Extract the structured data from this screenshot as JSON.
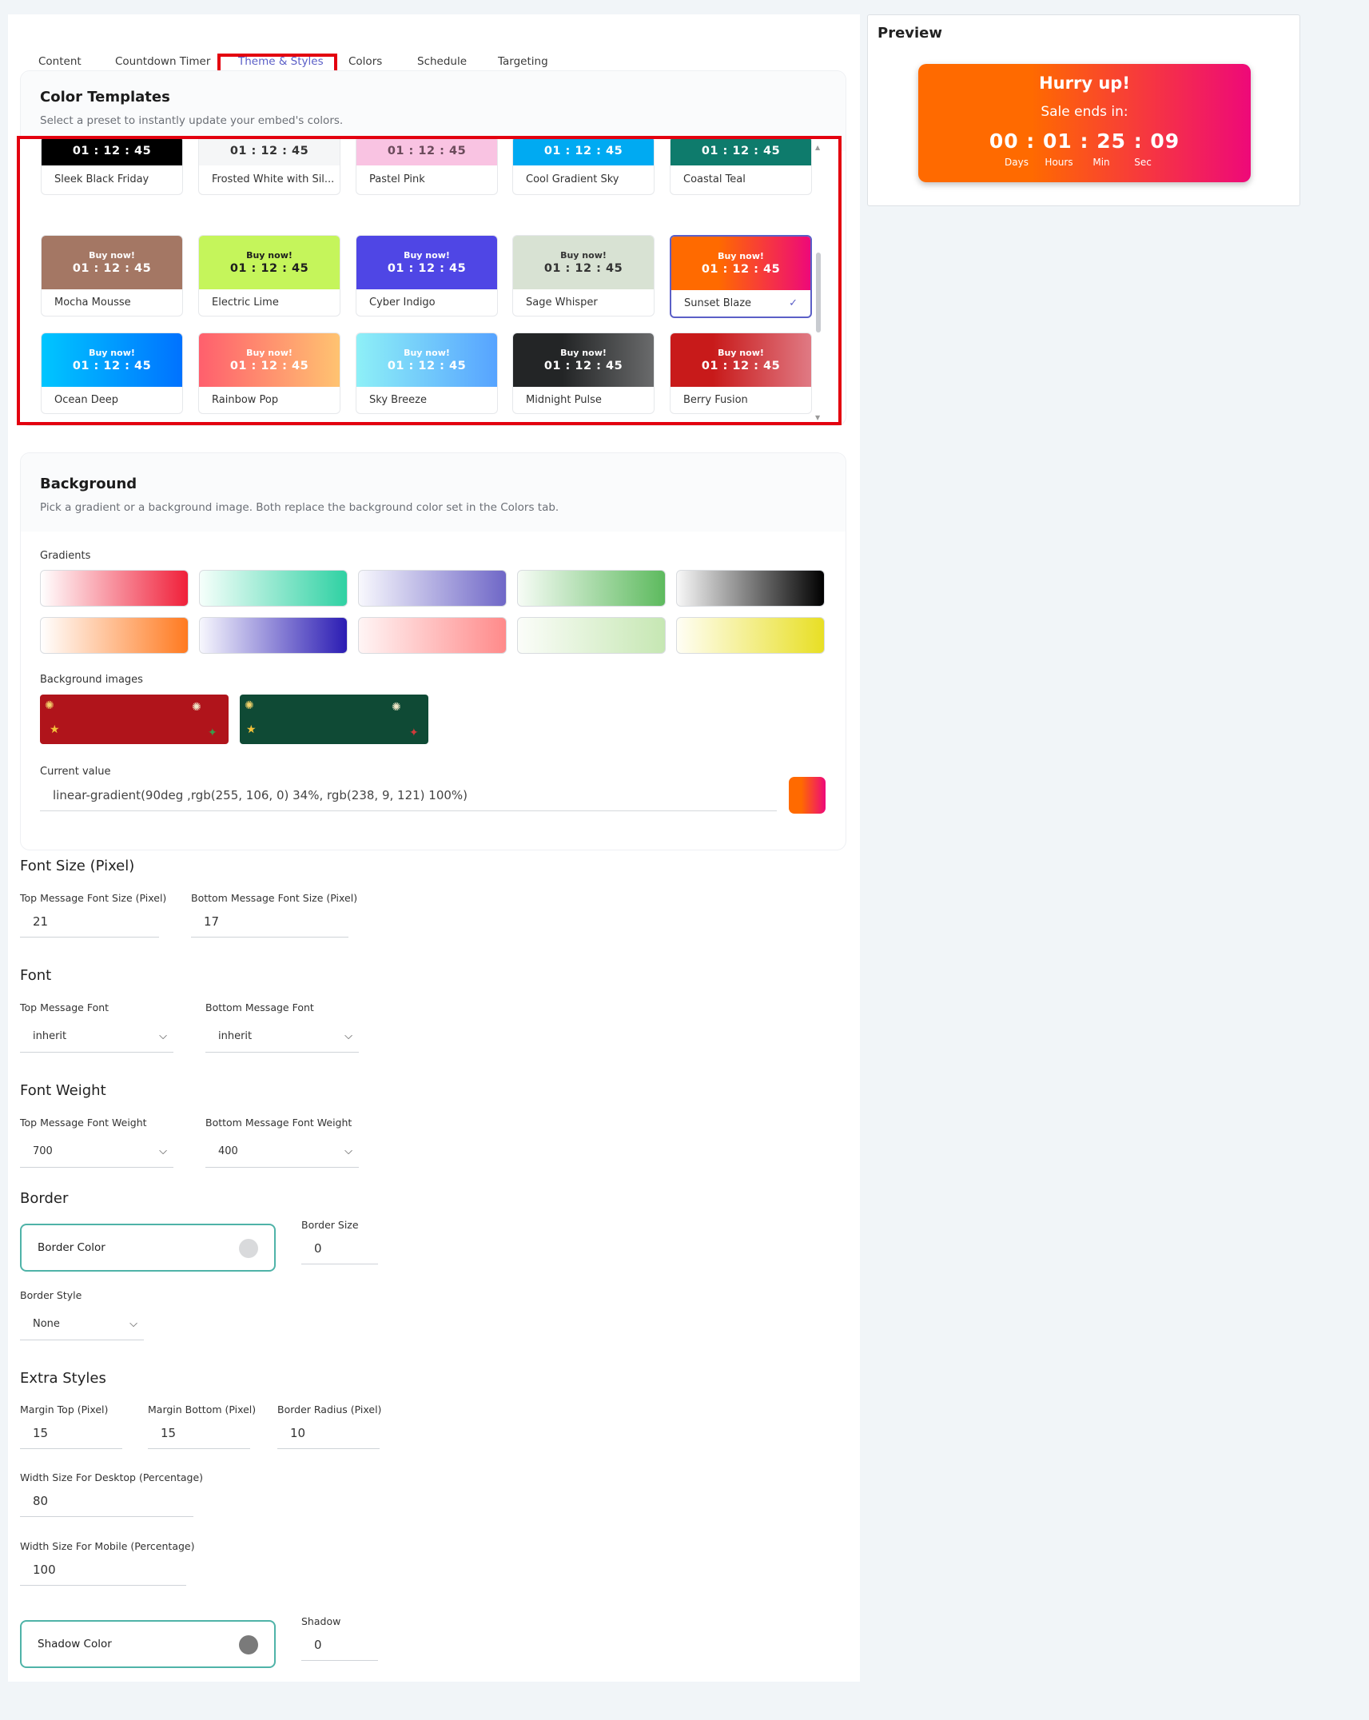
{
  "tabs": [
    {
      "label": "Content",
      "active": false
    },
    {
      "label": "Countdown Timer",
      "active": false
    },
    {
      "label": "Theme & Styles",
      "active": true
    },
    {
      "label": "Colors",
      "active": false
    },
    {
      "label": "Schedule",
      "active": false
    },
    {
      "label": "Targeting",
      "active": false
    }
  ],
  "color_templates": {
    "title": "Color Templates",
    "description": "Select a preset to instantly update your embed's colors.",
    "buy_label": "Buy now!",
    "time_label": "01 : 12 : 45",
    "selected": "Sunset Blaze",
    "templates": [
      {
        "name": "Sleek Black Friday",
        "background": "#000000",
        "text_color": "#ffffff"
      },
      {
        "name": "Frosted White with Sil...",
        "background": "#f5f6f7",
        "text_color": "#333333"
      },
      {
        "name": "Pastel Pink",
        "background": "#f9c3e2",
        "text_color": "#6a4a5a"
      },
      {
        "name": "Cool Gradient Sky",
        "background": "#00aaf2",
        "text_color": "#ffffff"
      },
      {
        "name": "Coastal Teal",
        "background": "#0e7b6c",
        "text_color": "#ffffff"
      },
      {
        "name": "Mocha Mousse",
        "background": "#a47764",
        "text_color": "#ffffff"
      },
      {
        "name": "Electric Lime",
        "background": "#c5f55b",
        "text_color": "#1e1e1e"
      },
      {
        "name": "Cyber Indigo",
        "background": "#4f46e5",
        "text_color": "#ffffff"
      },
      {
        "name": "Sage Whisper",
        "background": "#d8e2d3",
        "text_color": "#333333"
      },
      {
        "name": "Sunset Blaze",
        "background": "linear-gradient(90deg, #ff6a00 34%, #ee0979 100%)",
        "text_color": "#ffffff"
      },
      {
        "name": "Ocean Deep",
        "background": "linear-gradient(90deg, #00c6ff 0%, #0072ff 100%)",
        "text_color": "#ffffff"
      },
      {
        "name": "Rainbow Pop",
        "background": "linear-gradient(90deg, #ff5f6d 0%, #ffc371 100%)",
        "text_color": "#ffffff"
      },
      {
        "name": "Sky Breeze",
        "background": "linear-gradient(90deg, #8ef0f7 0%, #56a3ff 100%)",
        "text_color": "#ffffff"
      },
      {
        "name": "Midnight Pulse",
        "background": "linear-gradient(90deg, #232526 35%, #6a6b6c 100%)",
        "text_color": "#ffffff"
      },
      {
        "name": "Berry Fusion",
        "background": "linear-gradient(90deg, #c81a1a 30%, #e07a84 100%)",
        "text_color": "#ffffff"
      }
    ]
  },
  "background": {
    "title": "Background",
    "description": "Pick a gradient or a background image. Both replace the background color set in the Colors tab.",
    "gradients_label": "Gradients",
    "gradients": [
      "linear-gradient(90deg, #ffffff 0%, #f0203a 100%)",
      "linear-gradient(90deg, #f6fffb 0%, #2fd1a3 100%)",
      "linear-gradient(90deg, #f8f8fd 0%, #6f67c7 100%)",
      "linear-gradient(90deg, #f7fcf6 0%, #5dba5e 100%)",
      "linear-gradient(90deg, #f8f8f8 0%, #000000 100%)",
      "linear-gradient(90deg, #ffffff 0%, #ff7a20 100%)",
      "linear-gradient(90deg, #f7f7fd 0%, #2b1cb3 100%)",
      "linear-gradient(90deg, #fff5f5 0%, #ff8a8a 100%)",
      "linear-gradient(90deg, #fbfdf9 0%, #c6e7b3 100%)",
      "linear-gradient(90deg, #fffef5 0%, #e8df24 100%)"
    ],
    "images_label": "Background images",
    "images": [
      {
        "name": "red-christmas",
        "color": "#b0141b"
      },
      {
        "name": "green-christmas",
        "color": "#0f4a35"
      }
    ],
    "current_label": "Current value",
    "current_value": "linear-gradient(90deg ,rgb(255, 106, 0) 34%, rgb(238, 9, 121) 100%)"
  },
  "font_size": {
    "title": "Font Size (Pixel)",
    "top_label": "Top Message Font Size (Pixel)",
    "top_value": "21",
    "bottom_label": "Bottom Message Font Size (Pixel)",
    "bottom_value": "17"
  },
  "font": {
    "title": "Font",
    "top_label": "Top Message Font",
    "top_value": "inherit",
    "bottom_label": "Bottom Message Font",
    "bottom_value": "inherit"
  },
  "font_weight": {
    "title": "Font Weight",
    "top_label": "Top Message Font Weight",
    "top_value": "700",
    "bottom_label": "Bottom Message Font Weight",
    "bottom_value": "400"
  },
  "border": {
    "title": "Border",
    "color_label": "Border Color",
    "color_value": "#d9dadc",
    "size_label": "Border Size",
    "size_value": "0",
    "style_label": "Border Style",
    "style_value": "None"
  },
  "extra": {
    "title": "Extra Styles",
    "margin_top_label": "Margin Top (Pixel)",
    "margin_top_value": "15",
    "margin_bottom_label": "Margin Bottom (Pixel)",
    "margin_bottom_value": "15",
    "radius_label": "Border Radius (Pixel)",
    "radius_value": "10",
    "desktop_label": "Width Size For Desktop (Percentage)",
    "desktop_value": "80",
    "mobile_label": "Width Size For Mobile (Percentage)",
    "mobile_value": "100",
    "shadow_color_label": "Shadow Color",
    "shadow_color_value": "#7a7a7a",
    "shadow_label": "Shadow",
    "shadow_value": "0"
  },
  "preview": {
    "title": "Preview",
    "top_message": "Hurry up!",
    "bottom_message": "Sale ends in:",
    "time": "00 : 01  : 25 : 09",
    "units": [
      "Days",
      "Hours",
      "Min",
      "Sec"
    ]
  },
  "icons": {
    "chevron": "chevron-down-icon",
    "check": "check-icon"
  }
}
